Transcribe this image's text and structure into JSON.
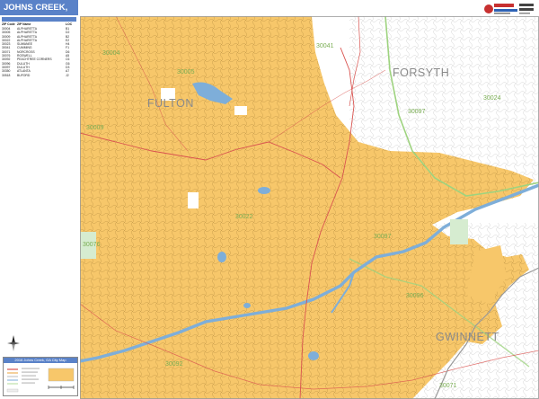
{
  "header": {
    "title": "JOHNS CREEK, GA"
  },
  "zip_table": {
    "columns": [
      "ZIP Code",
      "ZIP Name",
      "LOC"
    ],
    "rows": [
      {
        "zip": "30004",
        "name": "ALPHARETTA",
        "loc": "B1"
      },
      {
        "zip": "30005",
        "name": "ALPHARETTA",
        "loc": "D2"
      },
      {
        "zip": "30009",
        "name": "ALPHARETTA",
        "loc": "B2"
      },
      {
        "zip": "30022",
        "name": "ALPHARETTA",
        "loc": "E2"
      },
      {
        "zip": "30023",
        "name": "SUWANEE",
        "loc": "H4"
      },
      {
        "zip": "30041",
        "name": "CUMMING",
        "loc": "F1"
      },
      {
        "zip": "30071",
        "name": "NORCROSS",
        "loc": "D6"
      },
      {
        "zip": "30076",
        "name": "ROSWELL",
        "loc": "A5"
      },
      {
        "zip": "30092",
        "name": "PEACHTREE CORNERS",
        "loc": "C6"
      },
      {
        "zip": "30096",
        "name": "DULUTH",
        "loc": "G6"
      },
      {
        "zip": "30097",
        "name": "DULUTH",
        "loc": "D3"
      },
      {
        "zip": "30350",
        "name": "ATLANTA",
        "loc": "A7"
      },
      {
        "zip": "30518",
        "name": "BUFORD",
        "loc": "J2"
      }
    ]
  },
  "legend": {
    "title": "2016 Johns Creek, GA City Map"
  },
  "map": {
    "counties": [
      {
        "name": "FULTON"
      },
      {
        "name": "FORSYTH"
      },
      {
        "name": "GWINNETT"
      }
    ],
    "zip_labels": [
      {
        "text": "30004"
      },
      {
        "text": "30005"
      },
      {
        "text": "30009"
      },
      {
        "text": "30041"
      },
      {
        "text": "30097"
      },
      {
        "text": "30024"
      },
      {
        "text": "30022"
      },
      {
        "text": "30097"
      },
      {
        "text": "30096"
      },
      {
        "text": "30076"
      },
      {
        "text": "30092"
      },
      {
        "text": "30071"
      }
    ],
    "colors": {
      "city_area": "#f7c76a",
      "water": "#7eaed9",
      "roads_major": "#d9534f",
      "county_border": "#9ed37f"
    }
  }
}
